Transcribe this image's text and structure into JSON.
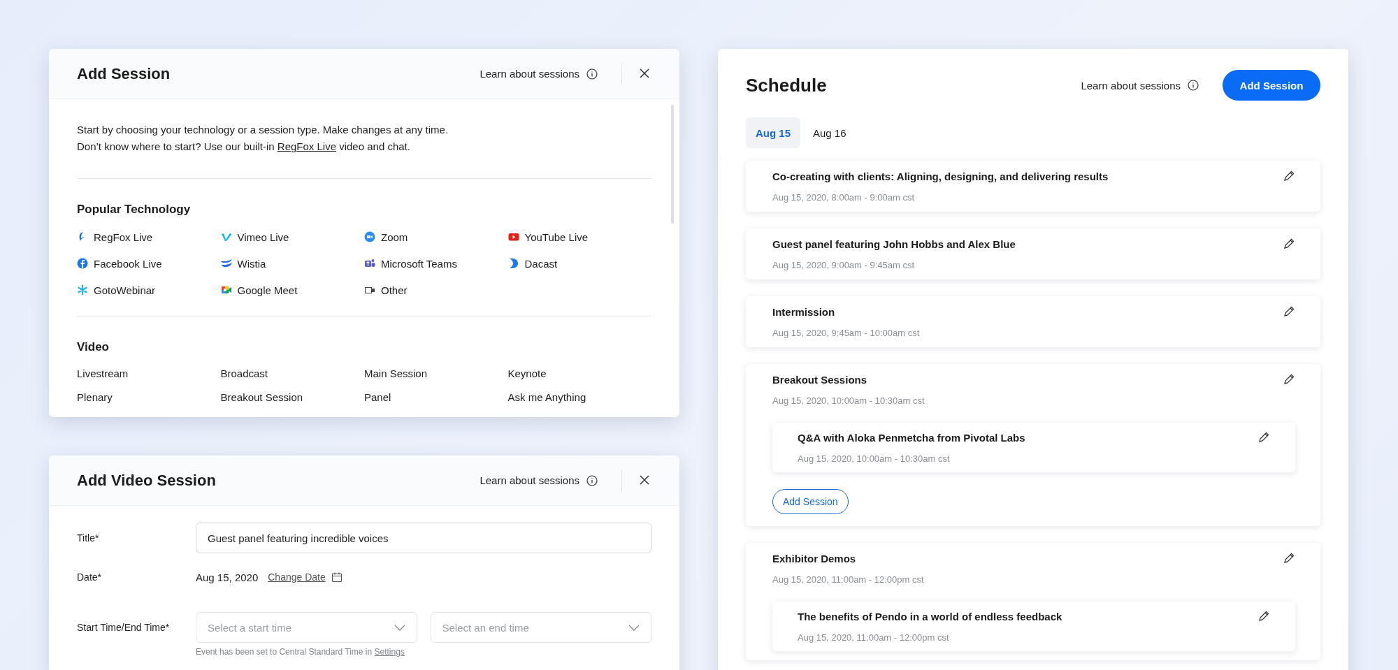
{
  "add_session_dialog": {
    "title": "Add Session",
    "learn_link": "Learn about sessions",
    "intro": [
      "Start by choosing your technology or a session type. Make changes at any time.",
      "Don’t know where to start? Use our built-in "
    ],
    "intro_link": "RegFox Live",
    "intro_end": " video and chat.",
    "technology_heading": "Popular Technology",
    "technologies": [
      {
        "label": "RegFox Live",
        "color": "#2b6fd6"
      },
      {
        "label": "Vimeo Live",
        "color": "#1ab7ea"
      },
      {
        "label": "Zoom",
        "color": "#2d8cff"
      },
      {
        "label": "YouTube Live",
        "color": "#e62117"
      },
      {
        "label": "Facebook Live",
        "color": "#1877f2"
      },
      {
        "label": "Wistia",
        "color": "#2f6be8"
      },
      {
        "label": "Microsoft Teams",
        "color": "#5b5fc7"
      },
      {
        "label": "Dacast",
        "color": "#1e7bf0"
      },
      {
        "label": "GotoWebinar",
        "color": "#20b8e0"
      },
      {
        "label": "Google Meet",
        "color": "#00a65a"
      },
      {
        "label": "Other",
        "color": "#444444"
      }
    ],
    "video_heading": "Video",
    "video_types": [
      "Livestream",
      "Broadcast",
      "Main Session",
      "Keynote",
      "Plenary",
      "Breakout Session",
      "Panel",
      "Ask me Anything"
    ]
  },
  "add_video_dialog": {
    "title": "Add Video Session",
    "learn_link": "Learn about sessions",
    "title_label": "Title*",
    "title_value": "Guest panel featuring incredible voices",
    "date_label": "Date*",
    "date_value": "Aug 15, 2020",
    "change_date": "Change Date",
    "time_label": "Start Time/End Time*",
    "start_placeholder": "Select a start time",
    "end_placeholder": "Select an end time",
    "hint": "Event has been set to Central Standard Time in ",
    "hint_link": "Settings"
  },
  "schedule": {
    "title": "Schedule",
    "learn_link": "Learn about sessions",
    "add_button": "Add Session",
    "tabs": [
      {
        "label": "Aug 15",
        "selected": true
      },
      {
        "label": "Aug 16",
        "selected": false
      }
    ],
    "sessions": [
      {
        "title": "Co-creating with clients: Aligning, designing, and delivering results",
        "time": "Aug 15, 2020, 8:00am - 9:00am cst"
      },
      {
        "title": "Guest panel featuring John Hobbs and Alex Blue",
        "time": "Aug 15, 2020, 9:00am - 9:45am cst"
      },
      {
        "title": "Intermission",
        "time": "Aug 15, 2020, 9:45am - 10:00am cst"
      },
      {
        "title": "Breakout Sessions",
        "time": "Aug 15, 2020, 10:00am - 10:30am cst",
        "children": [
          {
            "title": "Q&A with Aloka Penmetcha from Pivotal Labs",
            "time": "Aug 15, 2020, 10:00am - 10:30am cst"
          }
        ],
        "add_button": "Add Session"
      },
      {
        "title": "Exhibitor Demos",
        "time": "Aug 15, 2020, 11:00am - 12:00pm cst",
        "children": [
          {
            "title": "The benefits of Pendo in a world of endless feedback",
            "time": "Aug 15, 2020, 11:00am - 12:00pm cst"
          }
        ]
      }
    ]
  }
}
